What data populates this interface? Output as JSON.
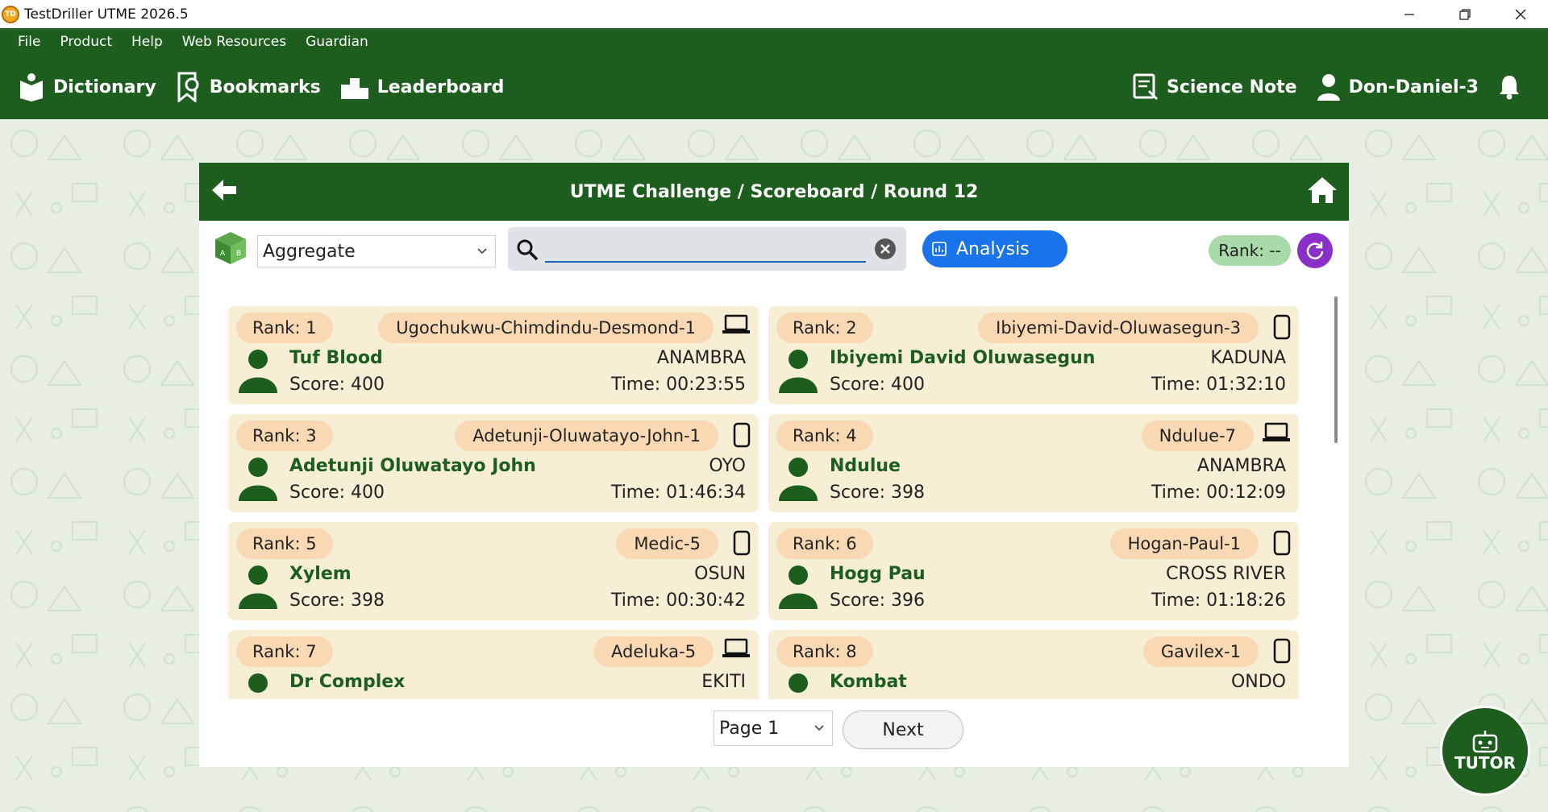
{
  "window": {
    "title": "TestDriller UTME 2026.5",
    "app_icon_text": "TD"
  },
  "menu": [
    "File",
    "Product",
    "Help",
    "Web Resources",
    "Guardian"
  ],
  "toolbar": {
    "dictionary": "Dictionary",
    "bookmarks": "Bookmarks",
    "leaderboard": "Leaderboard",
    "science_note": "Science Note",
    "user": "Don-Daniel-3"
  },
  "panel": {
    "title": "UTME Challenge / Scoreboard / Round 12",
    "filter_value": "Aggregate",
    "search_value": "",
    "analysis_label": "Analysis",
    "rank_label": "Rank: --"
  },
  "entries": [
    {
      "rank": "Rank: 1",
      "username": "Ugochukwu-Chimdindu-Desmond-1",
      "device": "laptop",
      "name": "Tuf Blood",
      "state": "ANAMBRA",
      "score": "Score: 400",
      "time": "Time: 00:23:55"
    },
    {
      "rank": "Rank: 2",
      "username": "Ibiyemi-David-Oluwasegun-3",
      "device": "phone",
      "name": "Ibiyemi David Oluwasegun",
      "state": "KADUNA",
      "score": "Score: 400",
      "time": "Time: 01:32:10"
    },
    {
      "rank": "Rank: 3",
      "username": "Adetunji-Oluwatayo-John-1",
      "device": "phone",
      "name": "Adetunji Oluwatayo John",
      "state": "OYO",
      "score": "Score: 400",
      "time": "Time: 01:46:34"
    },
    {
      "rank": "Rank: 4",
      "username": "Ndulue-7",
      "device": "laptop",
      "name": "Ndulue",
      "state": "ANAMBRA",
      "score": "Score: 398",
      "time": "Time: 00:12:09"
    },
    {
      "rank": "Rank: 5",
      "username": "Medic-5",
      "device": "phone",
      "name": "Xylem",
      "state": "OSUN",
      "score": "Score: 398",
      "time": "Time: 00:30:42"
    },
    {
      "rank": "Rank: 6",
      "username": "Hogan-Paul-1",
      "device": "phone",
      "name": "Hogg Pau",
      "state": "CROSS RIVER",
      "score": "Score: 396",
      "time": "Time: 01:18:26"
    },
    {
      "rank": "Rank: 7",
      "username": "Adeluka-5",
      "device": "laptop",
      "name": "Dr Complex",
      "state": "EKITI",
      "score": "",
      "time": ""
    },
    {
      "rank": "Rank: 8",
      "username": "Gavilex-1",
      "device": "phone",
      "name": "Kombat",
      "state": "ONDO",
      "score": "",
      "time": ""
    }
  ],
  "pager": {
    "page_value": "Page 1",
    "next_label": "Next"
  },
  "tutor_label": "TUTOR",
  "colors": {
    "brand_green": "#1d5e1f",
    "card_bg": "#f6efd6",
    "badge_bg": "#f9d9b3",
    "analysis_blue": "#1a73e8",
    "refresh_purple": "#8b2fc9",
    "rank_pill_green": "#a8d9a8"
  }
}
